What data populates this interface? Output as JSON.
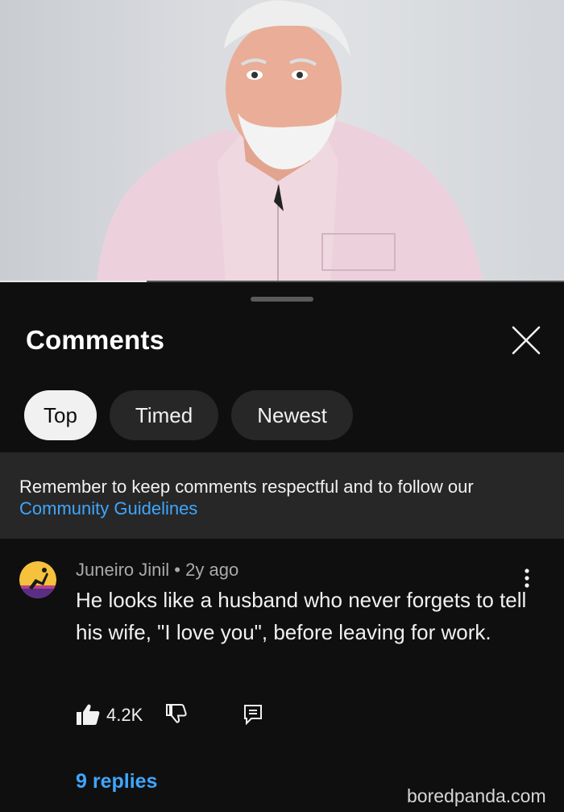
{
  "header": {
    "title": "Comments"
  },
  "filters": [
    "Top",
    "Timed",
    "Newest"
  ],
  "notice": {
    "text": "Remember to keep comments respectful and to follow our",
    "link": "Community Guidelines"
  },
  "comment": {
    "author": "Juneiro Jinil",
    "separator": "•",
    "age": "2y ago",
    "text": "He looks like a husband who never forgets to tell his wife, \"I love you\", before leaving for work.",
    "likes": "4.2K",
    "replies": "9 replies"
  },
  "watermark": "boredpanda.com",
  "icons": [
    "close-icon",
    "more-vert-icon",
    "thumb-up-icon",
    "thumb-down-icon",
    "reply-icon"
  ],
  "colors": {
    "background": "#0f0f0f",
    "surface": "#272727",
    "link": "#3ea6ff",
    "chip_active": "#f1f1f1"
  },
  "video": {
    "progress": 0.26
  }
}
